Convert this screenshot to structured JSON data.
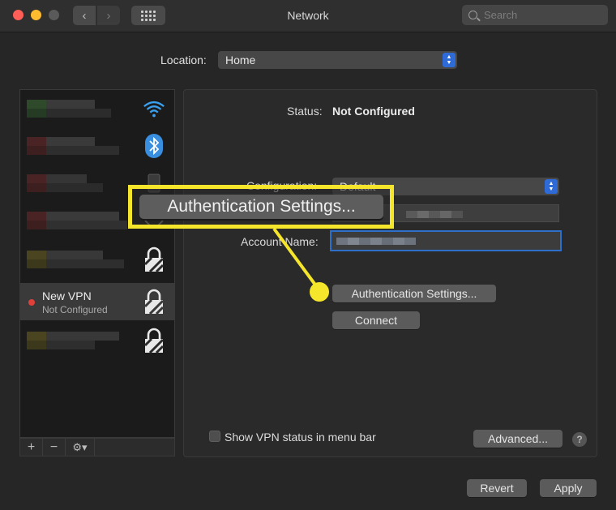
{
  "window": {
    "title": "Network"
  },
  "toolbar": {
    "back": "‹",
    "forward": "›",
    "search_placeholder": "Search"
  },
  "location": {
    "label": "Location:",
    "value": "Home"
  },
  "sidebar": {
    "selected": {
      "name": "New VPN",
      "status": "Not Configured"
    },
    "tools": {
      "add": "+",
      "remove": "−",
      "gear": "⚙︎▾"
    }
  },
  "panel": {
    "status_label": "Status:",
    "status_value": "Not Configured",
    "configuration_label": "Configuration:",
    "configuration_value": "Default",
    "account_label": "Account Name:",
    "auth_button": "Authentication Settings...",
    "connect_button": "Connect",
    "show_status_label": "Show VPN status in menu bar",
    "advanced_button": "Advanced...",
    "help": "?"
  },
  "footer": {
    "revert": "Revert",
    "apply": "Apply"
  },
  "callout": {
    "label": "Authentication Settings...",
    "color": "#f6e62b"
  },
  "colors": {
    "accent": "#2f6bd6",
    "status_dot": "#e0403a",
    "highlight": "#f6e62b"
  }
}
